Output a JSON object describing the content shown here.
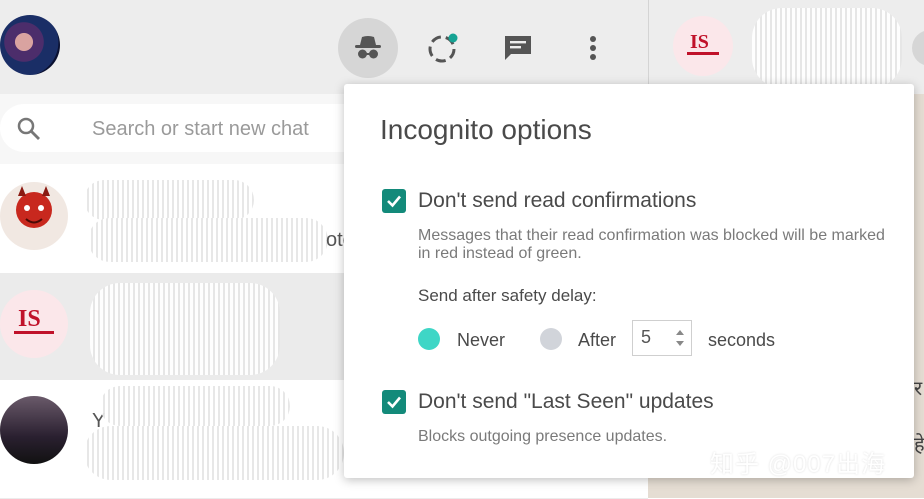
{
  "header": {
    "icons": [
      "incognito-icon",
      "status-icon",
      "new-chat-icon",
      "menu-icon"
    ]
  },
  "search": {
    "placeholder": "Search or start new chat"
  },
  "chats": [
    {
      "avatar_label": "Naughty",
      "snippet": "oto"
    },
    {
      "avatar_label": "IS"
    },
    {
      "snippet": "Y"
    }
  ],
  "incognito_popup": {
    "title": "Incognito options",
    "read_confirm": {
      "label": "Don't send read confirmations",
      "checked": true,
      "description": "Messages that their read confirmation was blocked will be marked in red instead of green."
    },
    "delay": {
      "label": "Send after safety delay:",
      "option_never": "Never",
      "option_after": "After",
      "selected": "Never",
      "value": "5",
      "unit": "seconds"
    },
    "last_seen": {
      "label": "Don't send \"Last Seen\" updates",
      "checked": true,
      "description": "Blocks outgoing presence updates."
    }
  },
  "watermark": "知乎 @007出海",
  "colors": {
    "checkbox": "#138a7a",
    "radio_on": "#3ed6c6",
    "radio_off": "#d1d4da",
    "header_bg": "#ededed"
  }
}
